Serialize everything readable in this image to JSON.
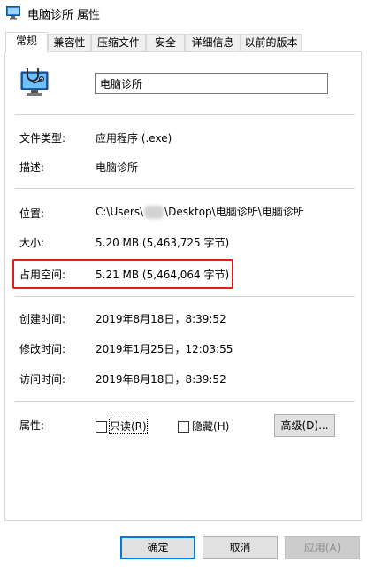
{
  "window": {
    "title": "电脑诊所 属性"
  },
  "tabs": [
    "常规",
    "兼容性",
    "压缩文件",
    "安全",
    "详细信息",
    "以前的版本"
  ],
  "file_name": "电脑诊所",
  "props": {
    "type_label": "文件类型:",
    "type_value": "应用程序 (.exe)",
    "desc_label": "描述:",
    "desc_value": "电脑诊所",
    "loc_label": "位置:",
    "loc_prefix": "C:\\Users\\",
    "loc_suffix": "\\Desktop\\电脑诊所\\电脑诊所",
    "size_label": "大小:",
    "size_value": "5.20 MB (5,463,725 字节)",
    "disk_label": "占用空间:",
    "disk_value": "5.21 MB (5,464,064 字节)",
    "created_label": "创建时间:",
    "created_value": "2019年8月18日，8:39:52",
    "modified_label": "修改时间:",
    "modified_value": "2019年1月25日，12:03:55",
    "accessed_label": "访问时间:",
    "accessed_value": "2019年8月18日，8:39:52"
  },
  "attributes": {
    "label": "属性:",
    "readonly": "只读(R)",
    "hidden": "隐藏(H)",
    "advanced": "高级(D)..."
  },
  "buttons": {
    "ok": "确定",
    "cancel": "取消",
    "apply": "应用(A)"
  }
}
